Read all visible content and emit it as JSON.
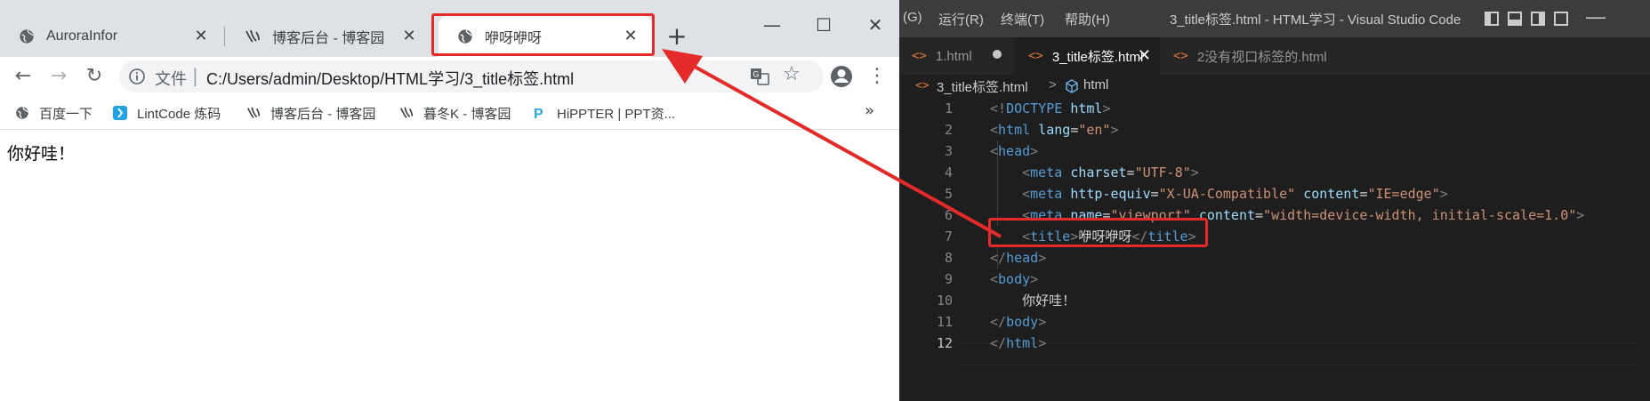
{
  "chrome": {
    "tabs": [
      {
        "title": "AuroraInfor",
        "icon": "globe-icon"
      },
      {
        "title": "博客后台 - 博客园",
        "icon": "cnblogs-icon"
      },
      {
        "title": "咿呀咿呀",
        "icon": "globe-icon",
        "active": true
      }
    ],
    "new_tab": "+",
    "window": {
      "minimize": "—",
      "maximize": "☐",
      "close": "✕"
    },
    "omnibox": {
      "site_label": "文件",
      "separator": "|",
      "url": "C:/Users/admin/Desktop/HTML学习/3_title标签.html"
    },
    "bookmarks": [
      {
        "label": "百度一下",
        "icon": "globe-icon"
      },
      {
        "label": "LintCode 炼码",
        "icon": "lintcode-icon"
      },
      {
        "label": "博客后台 - 博客园",
        "icon": "cnblogs-icon"
      },
      {
        "label": "暮冬K - 博客园",
        "icon": "cnblogs-icon"
      },
      {
        "label": "HiPPTER | PPT资...",
        "icon": "hippter-icon"
      }
    ],
    "bookmarks_more": "»",
    "page_text": "你好哇！"
  },
  "vscode": {
    "menu": [
      "(G)",
      "运行(R)",
      "终端(T)",
      "帮助(H)"
    ],
    "window_title": "3_title标签.html - HTML学习 - Visual Studio Code",
    "tabs": [
      {
        "label": "1.html",
        "state": "modified"
      },
      {
        "label": "3_title标签.html",
        "state": "active"
      },
      {
        "label": "2没有视口标签的.html",
        "state": "normal"
      }
    ],
    "breadcrumb": {
      "file": "3_title标签.html",
      "separator": ">",
      "node": "html"
    },
    "lines": [
      {
        "n": "1",
        "tokens": [
          [
            "br",
            "<!"
          ],
          [
            "tag",
            "DOCTYPE"
          ],
          [
            "txt",
            " "
          ],
          [
            "attr",
            "html"
          ],
          [
            "br",
            ">"
          ]
        ]
      },
      {
        "n": "2",
        "tokens": [
          [
            "br",
            "<"
          ],
          [
            "tag",
            "html"
          ],
          [
            "txt",
            " "
          ],
          [
            "attr",
            "lang"
          ],
          [
            "txt",
            "="
          ],
          [
            "str",
            "\"en\""
          ],
          [
            "br",
            ">"
          ]
        ]
      },
      {
        "n": "3",
        "tokens": [
          [
            "br",
            "<"
          ],
          [
            "tag",
            "head"
          ],
          [
            "br",
            ">"
          ]
        ]
      },
      {
        "n": "4",
        "tokens": [
          [
            "txt",
            "    "
          ],
          [
            "br",
            "<"
          ],
          [
            "tag",
            "meta"
          ],
          [
            "txt",
            " "
          ],
          [
            "attr",
            "charset"
          ],
          [
            "txt",
            "="
          ],
          [
            "str",
            "\"UTF-8\""
          ],
          [
            "br",
            ">"
          ]
        ]
      },
      {
        "n": "5",
        "tokens": [
          [
            "txt",
            "    "
          ],
          [
            "br",
            "<"
          ],
          [
            "tag",
            "meta"
          ],
          [
            "txt",
            " "
          ],
          [
            "attr",
            "http-equiv"
          ],
          [
            "txt",
            "="
          ],
          [
            "str",
            "\"X-UA-Compatible\""
          ],
          [
            "txt",
            " "
          ],
          [
            "attr",
            "content"
          ],
          [
            "txt",
            "="
          ],
          [
            "str",
            "\"IE=edge\""
          ],
          [
            "br",
            ">"
          ]
        ]
      },
      {
        "n": "6",
        "tokens": [
          [
            "txt",
            "    "
          ],
          [
            "br",
            "<"
          ],
          [
            "tag",
            "meta"
          ],
          [
            "txt",
            " "
          ],
          [
            "attr",
            "name"
          ],
          [
            "txt",
            "="
          ],
          [
            "str",
            "\"viewport\""
          ],
          [
            "txt",
            " "
          ],
          [
            "attr",
            "content"
          ],
          [
            "txt",
            "="
          ],
          [
            "str",
            "\"width=device-width, initial-scale=1.0\""
          ],
          [
            "br",
            ">"
          ]
        ]
      },
      {
        "n": "7",
        "tokens": [
          [
            "txt",
            "    "
          ],
          [
            "br",
            "<"
          ],
          [
            "tag",
            "title"
          ],
          [
            "br",
            ">"
          ],
          [
            "txt",
            "咿呀咿呀"
          ],
          [
            "br",
            "</"
          ],
          [
            "tag",
            "title"
          ],
          [
            "br",
            ">"
          ]
        ]
      },
      {
        "n": "8",
        "tokens": [
          [
            "br",
            "</"
          ],
          [
            "tag",
            "head"
          ],
          [
            "br",
            ">"
          ]
        ]
      },
      {
        "n": "9",
        "tokens": [
          [
            "br",
            "<"
          ],
          [
            "tag",
            "body"
          ],
          [
            "br",
            ">"
          ]
        ]
      },
      {
        "n": "10",
        "tokens": [
          [
            "txt",
            "    你好哇！"
          ]
        ]
      },
      {
        "n": "11",
        "tokens": [
          [
            "br",
            "</"
          ],
          [
            "tag",
            "body"
          ],
          [
            "br",
            ">"
          ]
        ]
      },
      {
        "n": "12",
        "tokens": [
          [
            "br",
            "</"
          ],
          [
            "tag",
            "html"
          ],
          [
            "br",
            ">"
          ]
        ]
      }
    ],
    "current_line": "12"
  },
  "colors": {
    "annotation": "#e52a2a",
    "vscode_bg": "#1e1e1e",
    "chrome_tabstrip": "#dee1e6"
  }
}
